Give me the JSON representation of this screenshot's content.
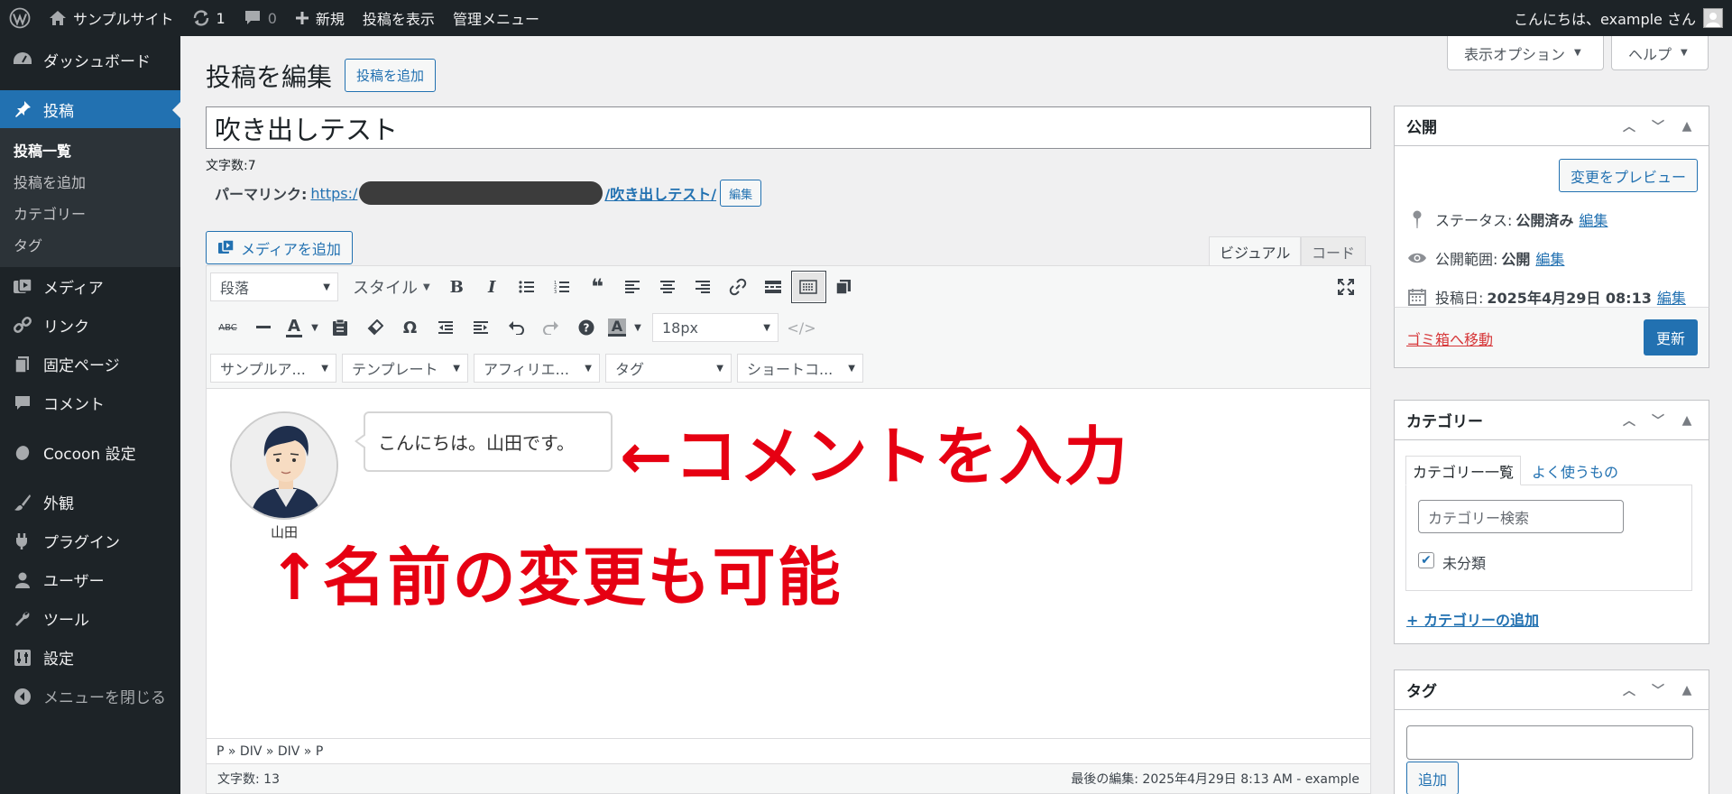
{
  "adminbar": {
    "site_name": "サンプルサイト",
    "updates_count": "1",
    "comments_count": "0",
    "new_label": "新規",
    "view_post": "投稿を表示",
    "admin_menu": "管理メニュー",
    "greeting": "こんにちは、example さん"
  },
  "sidebar": {
    "items": [
      {
        "label": "ダッシュボード",
        "icon": "dashboard-icon"
      },
      {
        "label": "投稿",
        "icon": "pin-icon"
      },
      {
        "label": "メディア",
        "icon": "media-icon"
      },
      {
        "label": "リンク",
        "icon": "link-icon"
      },
      {
        "label": "固定ページ",
        "icon": "pages-icon"
      },
      {
        "label": "コメント",
        "icon": "comment-icon"
      },
      {
        "label": "Cocoon 設定",
        "icon": "cocoon-icon"
      },
      {
        "label": "外観",
        "icon": "brush-icon"
      },
      {
        "label": "プラグイン",
        "icon": "plugin-icon"
      },
      {
        "label": "ユーザー",
        "icon": "user-icon"
      },
      {
        "label": "ツール",
        "icon": "wrench-icon"
      },
      {
        "label": "設定",
        "icon": "settings-icon"
      }
    ],
    "submenu": [
      "投稿一覧",
      "投稿を追加",
      "カテゴリー",
      "タグ"
    ],
    "collapse_label": "メニューを閉じる"
  },
  "header": {
    "screen_options": "表示オプション",
    "help": "ヘルプ",
    "title": "投稿を編集",
    "add_new": "投稿を追加"
  },
  "post": {
    "title": "吹き出しテスト",
    "char_count": "文字数:7",
    "permalink_label": "パーマリンク:",
    "permalink_prefix": "https:/",
    "permalink_slug": "/吹き出しテスト/",
    "permalink_edit": "編集"
  },
  "editor": {
    "add_media": "メディアを追加",
    "tab_visual": "ビジュアル",
    "tab_code": "コード",
    "format_select": "段落",
    "style_dropdown": "スタイル",
    "fontsize_select": "18px",
    "row3_selects": [
      "サンプルア...",
      "テンプレート",
      "アフィリエ...",
      "タグ",
      "ショートコ..."
    ],
    "balloon_name": "山田",
    "balloon_text": "こんにちは。山田です。",
    "annotation_1": "←コメントを入力",
    "annotation_2": "↑名前の変更も可能",
    "annotation_color": "#e60012",
    "path": "P » DIV » DIV » P",
    "word_count": "文字数: 13",
    "last_edited": "最後の編集: 2025年4月29日 8:13 AM - example"
  },
  "publish": {
    "title": "公開",
    "preview": "変更をプレビュー",
    "status_label": "ステータス:",
    "status_value": "公開済み",
    "visibility_label": "公開範囲:",
    "visibility_value": "公開",
    "date_label": "投稿日:",
    "date_value": "2025年4月29日 08:13",
    "edit": "編集",
    "trash": "ゴミ箱へ移動",
    "update": "更新"
  },
  "categories": {
    "title": "カテゴリー",
    "tab_all": "カテゴリー一覧",
    "tab_popular": "よく使うもの",
    "search_placeholder": "カテゴリー検索",
    "item": "未分類",
    "add_new": "+ カテゴリーの追加"
  },
  "tags": {
    "title": "タグ",
    "add": "追加"
  },
  "colors": {
    "admin_bg": "#1d2327",
    "accent": "#2271b1",
    "danger": "#d63638"
  }
}
